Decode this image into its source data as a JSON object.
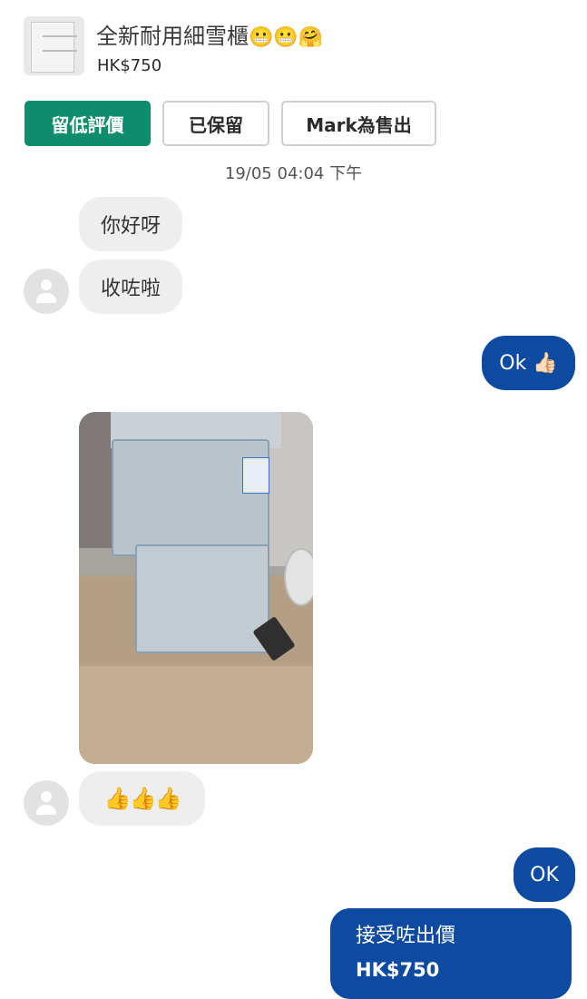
{
  "listing": {
    "title": "全新耐用細雪櫃",
    "title_emojis": "😬😬🤗",
    "price": "HK$750",
    "thumbnail_icon": "fridge-thumbnail"
  },
  "actions": {
    "review_label": "留低評價",
    "reserved_label": "已保留",
    "sold_label": "Mark為售出"
  },
  "timestamp": "19/05 04:04 下午",
  "messages": {
    "m1": "你好呀",
    "m2": "收咗啦",
    "m3": "Ok 👍🏻",
    "m5": "👍👍👍",
    "m6": "OK",
    "offer_label": "接受咗出價",
    "offer_price": "HK$750"
  },
  "colors": {
    "primary_green": "#0f8c6c",
    "outgoing_blue": "#0d4aa1",
    "incoming_gray": "#eeeeee"
  }
}
